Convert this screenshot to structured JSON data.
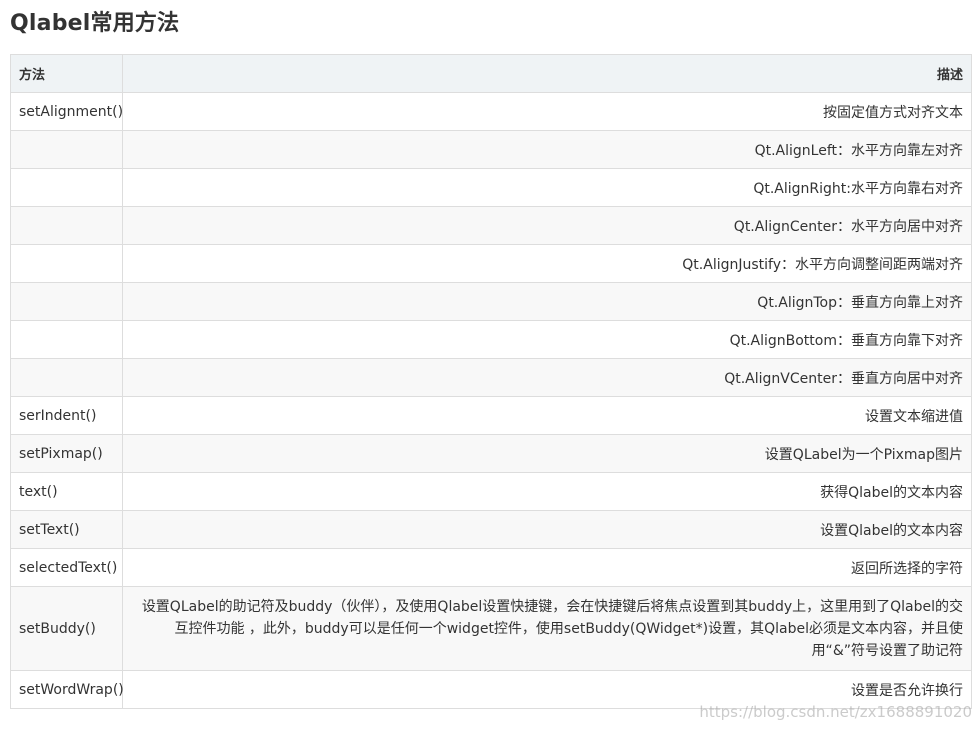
{
  "page": {
    "title": "Qlabel常用方法"
  },
  "table": {
    "headers": {
      "method": "方法",
      "description": "描述"
    },
    "rows": [
      {
        "method": "setAlignment()",
        "description": "按固定值方式对齐文本"
      },
      {
        "method": "",
        "description": "Qt.AlignLeft：水平方向靠左对齐"
      },
      {
        "method": "",
        "description": "Qt.AlignRight:水平方向靠右对齐"
      },
      {
        "method": "",
        "description": "Qt.AlignCenter：水平方向居中对齐"
      },
      {
        "method": "",
        "description": "Qt.AlignJustify：水平方向调整间距两端对齐"
      },
      {
        "method": "",
        "description": "Qt.AlignTop：垂直方向靠上对齐"
      },
      {
        "method": "",
        "description": "Qt.AlignBottom：垂直方向靠下对齐"
      },
      {
        "method": "",
        "description": "Qt.AlignVCenter：垂直方向居中对齐"
      },
      {
        "method": "serIndent()",
        "description": "设置文本缩进值"
      },
      {
        "method": "setPixmap()",
        "description": "设置QLabel为一个Pixmap图片"
      },
      {
        "method": "text()",
        "description": "获得Qlabel的文本内容"
      },
      {
        "method": "setText()",
        "description": "设置Qlabel的文本内容"
      },
      {
        "method": "selectedText()",
        "description": "返回所选择的字符"
      },
      {
        "method": "setBuddy()",
        "description": "设置QLabel的助记符及buddy（伙伴），及使用Qlabel设置快捷键，会在快捷键后将焦点设置到其buddy上，这里用到了Qlabel的交互控件功能 ，此外，buddy可以是任何一个widget控件，使用setBuddy(QWidget*)设置，其Qlabel必须是文本内容，并且使用“&”符号设置了助记符"
      },
      {
        "method": "setWordWrap()",
        "description": "设置是否允许换行"
      }
    ]
  },
  "watermark": {
    "text": "https://blog.csdn.net/zx1688891020"
  }
}
